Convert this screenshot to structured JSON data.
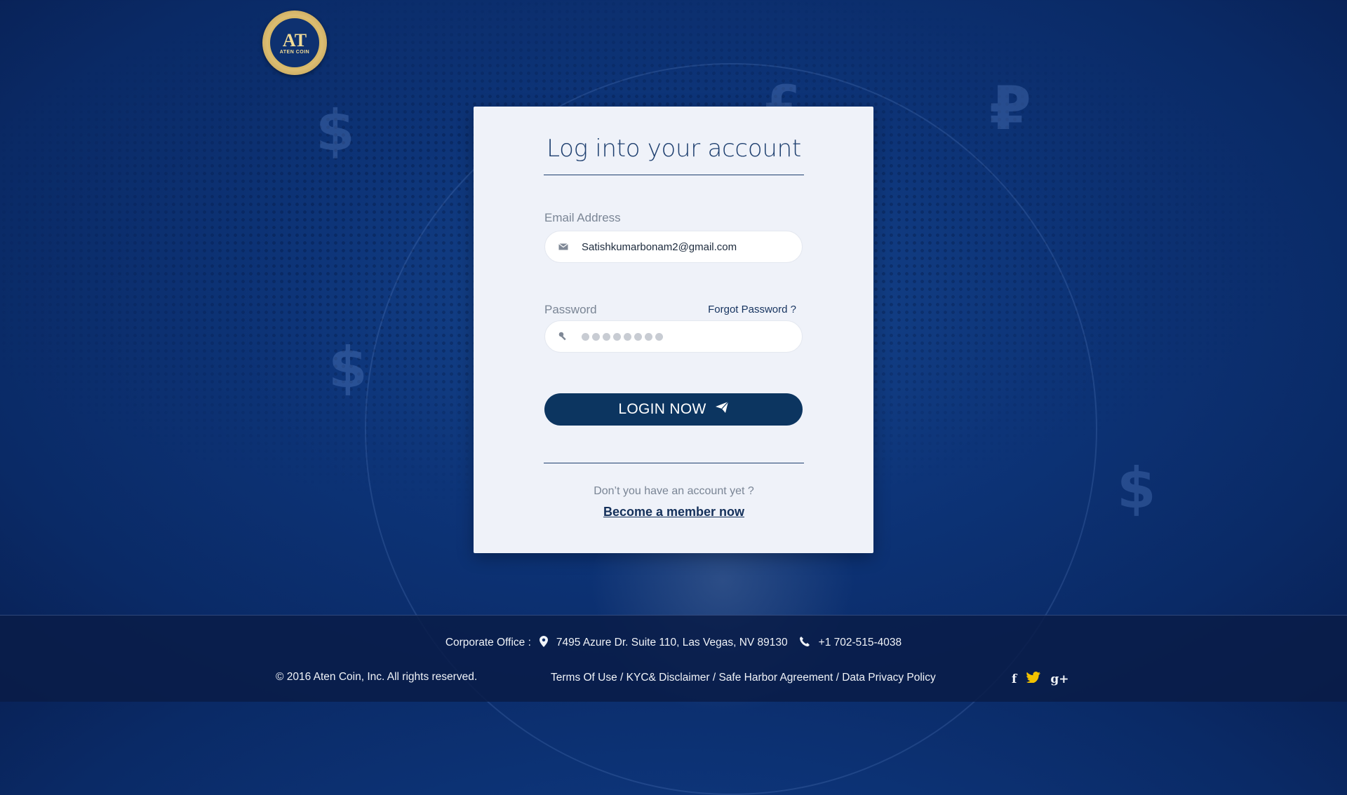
{
  "brand": {
    "logo_mark": "AT",
    "logo_text": "ATEN COIN"
  },
  "login": {
    "title": "Log into your account",
    "email_label": "Email Address",
    "email_value": "Satishkumarbonam2@gmail.com",
    "password_label": "Password",
    "forgot_label": "Forgot Password ?",
    "login_button": "LOGIN NOW",
    "signup_question": "Don’t you have an account yet ?",
    "signup_link": "Become a member now"
  },
  "footer": {
    "office_label": "Corporate Office  :",
    "address": "7495 Azure Dr. Suite 110, Las Vegas, NV 89130",
    "phone": "+1 702-515-4038",
    "copyright": "© 2016 Aten Coin, Inc. All rights reserved.",
    "links": {
      "terms": "Terms Of Use",
      "kyc": "KYC& Disclaimer",
      "safe_harbor": "Safe Harbor Agreement",
      "privacy": "Data Privacy Policy",
      "separator": " / "
    },
    "socials": {
      "facebook": "f",
      "twitter": "🐦",
      "google": "g+"
    }
  },
  "colors": {
    "background": "#0d3478",
    "card": "#eff2f9",
    "primary_button": "#0c3560",
    "accent_twitter": "#f2c200"
  },
  "icons": {
    "email": "mail-icon",
    "password": "key-icon",
    "button": "paper-plane-icon",
    "address": "map-pin-icon",
    "phone": "phone-icon"
  }
}
